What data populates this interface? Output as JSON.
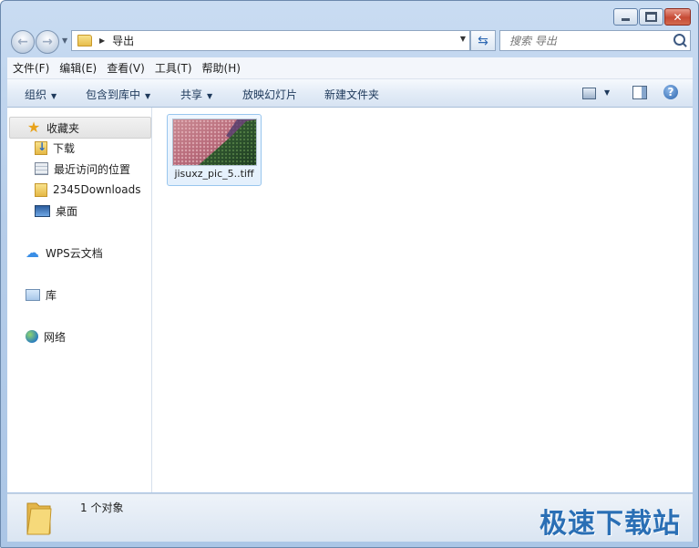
{
  "window": {
    "caption": {
      "close_glyph": "✕"
    }
  },
  "nav": {
    "address_path": "导出",
    "search_placeholder": "搜索 导出"
  },
  "menu": [
    "文件(F)",
    "编辑(E)",
    "查看(V)",
    "工具(T)",
    "帮助(H)"
  ],
  "commands": {
    "organize": "组织",
    "include_library": "包含到库中",
    "share": "共享",
    "slideshow": "放映幻灯片",
    "new_folder": "新建文件夹"
  },
  "sidebar": {
    "favorites": {
      "label": "收藏夹",
      "items": [
        {
          "label": "下载",
          "icon": "download-folder-icon"
        },
        {
          "label": "最近访问的位置",
          "icon": "recent-places-icon"
        },
        {
          "label": "2345Downloads",
          "icon": "folder-icon"
        },
        {
          "label": "桌面",
          "icon": "desktop-icon"
        }
      ]
    },
    "wps": "WPS云文档",
    "library": "库",
    "network": "网络"
  },
  "files": [
    {
      "name": "jisuxz_pic_5..tiff",
      "type": "tiff image"
    }
  ],
  "status": {
    "count_text": "1 个对象",
    "watermark": "极速下载站"
  },
  "colors": {
    "accent": "#2a6fb5",
    "selection": "#99c6ee",
    "frame": "#b6cde9"
  }
}
